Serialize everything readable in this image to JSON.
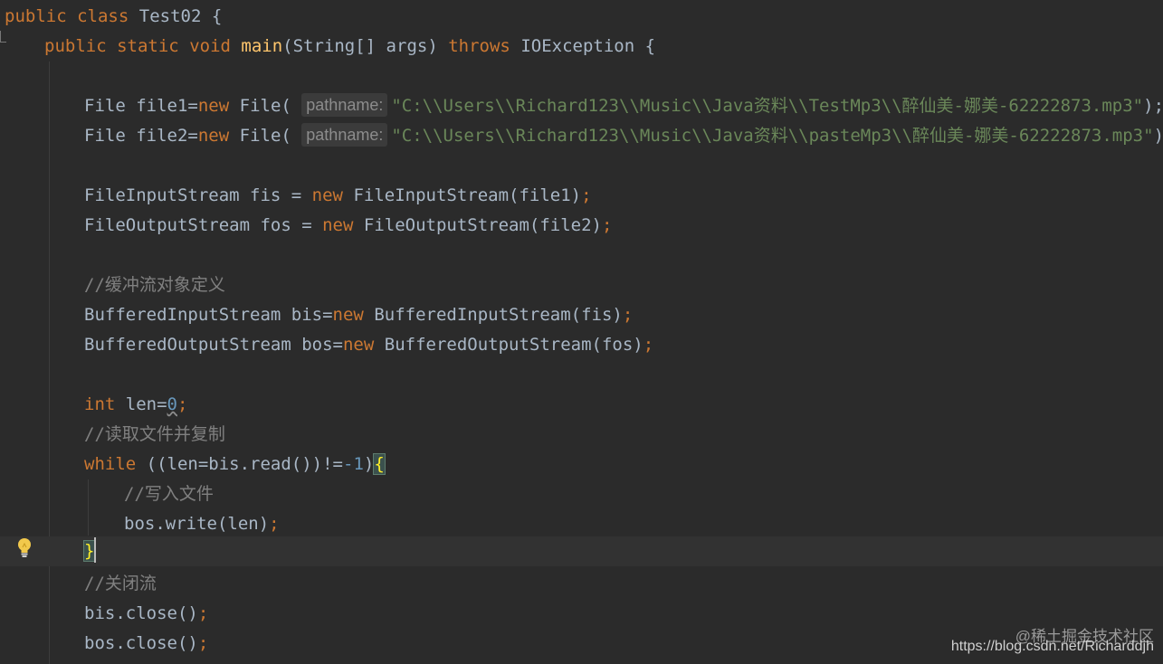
{
  "editor": {
    "lines": {
      "l1": {
        "kw1": "public",
        "kw2": "class",
        "name": "Test02",
        "brace": "{"
      },
      "l2": {
        "kw1": "public",
        "kw2": "static",
        "kw3": "void",
        "fn": "main",
        "params": "(String[] args)",
        "kw4": "throws",
        "ex": "IOException",
        "brace": "{"
      },
      "l4": {
        "decl": "File file1=",
        "kw": "new",
        "call": "File(",
        "hint": "pathname:",
        "str": "\"C:\\\\Users\\\\Richard123\\\\Music\\\\Java资料\\\\TestMp3\\\\醉仙美-娜美-62222873.mp3\"",
        "end": ");"
      },
      "l5": {
        "decl": "File file2=",
        "kw": "new",
        "call": "File(",
        "hint": "pathname:",
        "str": "\"C:\\\\Users\\\\Richard123\\\\Music\\\\Java资料\\\\pasteMp3\\\\醉仙美-娜美-62222873.mp3\"",
        "end": ");"
      },
      "l7": {
        "decl": "FileInputStream fis = ",
        "kw": "new",
        "call": "FileInputStream(file1)",
        "semi": ";"
      },
      "l8": {
        "decl": "FileOutputStream fos = ",
        "kw": "new",
        "call": "FileOutputStream(file2)",
        "semi": ";"
      },
      "l10": {
        "comment": "//缓冲流对象定义"
      },
      "l11": {
        "decl": "BufferedInputStream bis=",
        "kw": "new",
        "call": "BufferedInputStream(fis)",
        "semi": ";"
      },
      "l12": {
        "decl": "BufferedOutputStream bos=",
        "kw": "new",
        "call": "BufferedOutputStream(fos)",
        "semi": ";"
      },
      "l14": {
        "kw": "int",
        "decl": "len=",
        "num": "0",
        "semi": ";"
      },
      "l15": {
        "comment": "//读取文件并复制"
      },
      "l16": {
        "kw": "while",
        "cond1": "((len=bis.read())!=",
        "num": "-1",
        "cond2": ")",
        "brace": "{"
      },
      "l17": {
        "comment": "//写入文件"
      },
      "l18": {
        "call": "bos.write(len)",
        "semi": ";"
      },
      "l19": {
        "brace": "}"
      },
      "l20": {
        "comment": "//关闭流"
      },
      "l21": {
        "call": "bis.close()",
        "semi": ";"
      },
      "l22": {
        "call": "bos.close()",
        "semi": ";"
      }
    }
  },
  "watermark": {
    "site": "@稀土掘金技术社区",
    "url": "https://blog.csdn.net/Richarddjh"
  },
  "colors": {
    "background": "#2b2b2b",
    "keyword": "#cc7832",
    "function": "#ffc66d",
    "string": "#6a8759",
    "number": "#6897bb",
    "comment": "#808080",
    "text": "#a9b7c6"
  },
  "icons": {
    "gutter": "lightbulb-icon"
  }
}
